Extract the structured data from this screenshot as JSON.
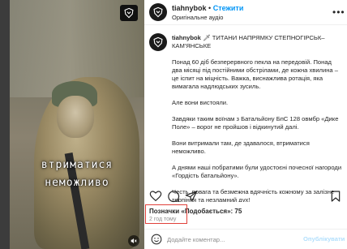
{
  "post": {
    "username": "tiahnybok",
    "separator": "•",
    "follow_label": "Стежити",
    "audio_label": "Оригінальне аудіо",
    "more_label": "•••"
  },
  "video": {
    "caption_line1": "втриматися",
    "caption_line2": "неможливо",
    "badge_icon": "brigade-emblem-icon",
    "mute_icon": "speaker-off-icon"
  },
  "caption": {
    "username": "tiahnybok",
    "title": "🗡 ТИТАНИ НАПРЯМКУ СТЕПНОГІРСЬК–КАМ'ЯНСЬКЕ",
    "paragraphs": [
      "Понад 60 діб безперервного пекла на передовій. Понад два місяці під постійними обстрілами, де кожна хвилина – це іспит на міцність. Важка, виснажлива ротація, яка вимагала надлюдських зусиль.",
      "Але вони вистояли.",
      "Завдяки таким воїнам з Батальйону БпС 128 овмбр «Дике Поле» – ворог не пройшов і відкинутий далі.",
      "Вони витримали там, де здавалося, втриматися неможливо.",
      "А днями наші побратими були удостоєні почесної нагороди «Гордість батальйону».",
      "Честь, повага та безмежна вдячність кожному за залізне терпіння та незламний дух!"
    ]
  },
  "actions": {
    "like_icon": "heart-icon",
    "comment_icon": "comment-icon",
    "share_icon": "paper-plane-icon",
    "save_icon": "bookmark-icon"
  },
  "stats": {
    "likes_label": "Позначки «Подобається»: 75",
    "time_label": "2 год тому"
  },
  "comment": {
    "placeholder": "Додайте коментар...",
    "publish_label": "Опублікувати"
  },
  "colors": {
    "accent": "#0095f6",
    "publish_disabled": "#b2dffc",
    "highlight_box": "#e0403a"
  }
}
